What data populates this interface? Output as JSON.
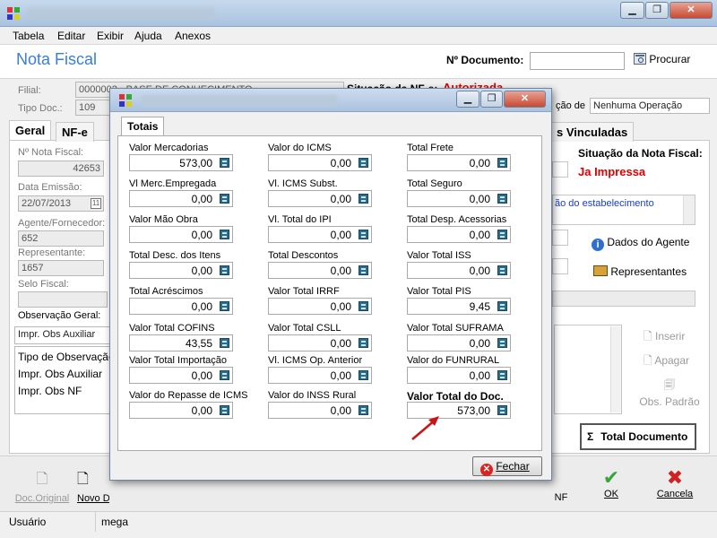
{
  "menu": [
    "Tabela",
    "Editar",
    "Exibir",
    "Ajuda",
    "Anexos"
  ],
  "header": {
    "title": "Nota Fiscal",
    "doc_label": "Nº Documento:",
    "search_label": "Procurar"
  },
  "form": {
    "filial_label": "Filial:",
    "filial_value": "0000002 - BASE DE CONHECIMENTO",
    "situacao_label": "Situação da NF-e:",
    "situacao_value": "Autorizada",
    "tipo_label": "Tipo Doc.:",
    "tipo_value": "109",
    "operacao_partial": "ção de",
    "operacao_value": "Nenhuma Operação",
    "tab_geral": "Geral",
    "tab_nfe": "NF-e",
    "tab_vinculadas": "s Vinculadas",
    "nf_label": "Nº Nota Fiscal:",
    "nf_value": "42653",
    "emissao_label": "Data Emissão:",
    "emissao_value": "22/07/2013",
    "agente_label": "Agente/Fornecedor:",
    "agente_value": "652",
    "repr_label": "Representante:",
    "repr_value": "1657",
    "selo_label": "Selo Fiscal:",
    "obs_label": "Observação Geral:",
    "obs_select": "Impr. Obs Auxiliar",
    "obs_list": [
      "Tipo de Observação",
      "Impr. Obs Auxiliar",
      "Impr. Obs NF"
    ],
    "sit_nf_label": "Situação da Nota Fiscal:",
    "sit_nf_value": "Ja Impressa",
    "estab_text": "ão do estabelecimento",
    "dados_agente": "Dados do Agente",
    "representantes": "Representantes",
    "inserir": "Inserir",
    "apagar": "Apagar",
    "obs_padrao": "Obs. Padrão",
    "total_documento": "Total Documento"
  },
  "toolbar": {
    "doc_original": "Doc.Original",
    "novo": "Novo D",
    "nf_partial": "NF",
    "ok": "OK",
    "cancela": "Cancela"
  },
  "status": {
    "user_label": "Usuário",
    "user_value": "mega"
  },
  "modal": {
    "tab": "Totais",
    "close_label": "Fechar",
    "fields": [
      {
        "label": "Valor Mercadorias",
        "value": "573,00"
      },
      {
        "label": "Valor do ICMS",
        "value": "0,00"
      },
      {
        "label": "Total Frete",
        "value": "0,00"
      },
      {
        "label": "Vl Merc.Empregada",
        "value": "0,00"
      },
      {
        "label": "Vl. ICMS Subst.",
        "value": "0,00"
      },
      {
        "label": "Total Seguro",
        "value": "0,00"
      },
      {
        "label": "Valor Mão Obra",
        "value": "0,00"
      },
      {
        "label": "Vl. Total do IPI",
        "value": "0,00"
      },
      {
        "label": "Total Desp. Acessorias",
        "value": "0,00"
      },
      {
        "label": "Total Desc. dos Itens",
        "value": "0,00"
      },
      {
        "label": "Total Descontos",
        "value": "0,00"
      },
      {
        "label": "Valor Total ISS",
        "value": "0,00"
      },
      {
        "label": "Total Acréscimos",
        "value": "0,00"
      },
      {
        "label": "Valor Total IRRF",
        "value": "0,00"
      },
      {
        "label": "Valor Total PIS",
        "value": "9,45"
      },
      {
        "label": "Valor Total COFINS",
        "value": "43,55"
      },
      {
        "label": "Valor Total CSLL",
        "value": "0,00"
      },
      {
        "label": "Valor Total SUFRAMA",
        "value": "0,00"
      },
      {
        "label": "Valor Total Importação",
        "value": "0,00"
      },
      {
        "label": "Vl. ICMS Op. Anterior",
        "value": "0,00"
      },
      {
        "label": "Valor do FUNRURAL",
        "value": "0,00"
      },
      {
        "label": "Valor do Repasse de ICMS",
        "value": "0,00"
      },
      {
        "label": "Valor do INSS Rural",
        "value": "0,00"
      },
      {
        "label": "Valor Total do Doc.",
        "value": "573,00"
      }
    ]
  },
  "colors": {
    "accent": "#3a7fd0",
    "alert": "#e00000"
  }
}
